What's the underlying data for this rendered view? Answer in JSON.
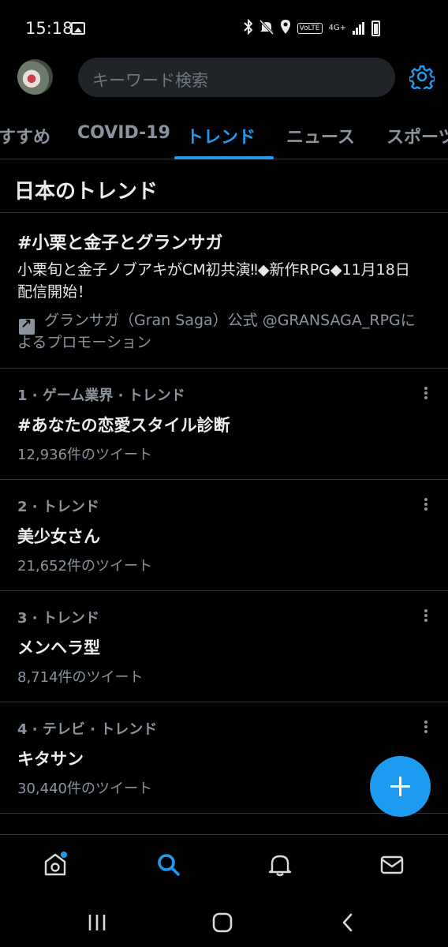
{
  "status_bar": {
    "time": "15:18",
    "volte": "VoLTE",
    "network": "4G+"
  },
  "header": {
    "search_placeholder": "キーワード検索"
  },
  "tabs": [
    {
      "label": "すすめ",
      "active": false
    },
    {
      "label": "COVID-19",
      "active": false
    },
    {
      "label": "トレンド",
      "active": true
    },
    {
      "label": "ニュース",
      "active": false
    },
    {
      "label": "スポーツ",
      "active": false
    }
  ],
  "section_title": "日本のトレンド",
  "promoted": {
    "title": "#小栗と金子とグランサガ",
    "description": "小栗旬と金子ノブアキがCM初共演‼◆新作RPG◆11月18日配信開始！",
    "promoted_by": "グランサガ（Gran Saga）公式 @GRANSAGA_RPGによるプロモーション"
  },
  "trends": [
    {
      "meta": "1 · ゲーム業界 · トレンド",
      "name": "#あなたの恋愛スタイル診断",
      "count": "12,936件のツイート"
    },
    {
      "meta": "2 · トレンド",
      "name": "美少女さん",
      "count": "21,652件のツイート"
    },
    {
      "meta": "3 · トレンド",
      "name": "メンヘラ型",
      "count": "8,714件のツイート"
    },
    {
      "meta": "4 · テレビ · トレンド",
      "name": "キタサン",
      "count": "30,440件のツイート"
    }
  ],
  "colors": {
    "accent": "#1d9bf0",
    "background": "#000000",
    "secondary_text": "#8b949e"
  },
  "bottom_nav": [
    "home-icon",
    "search-icon",
    "notifications-icon",
    "messages-icon"
  ],
  "system_nav": [
    "recents-icon",
    "home-circle-icon",
    "back-icon"
  ]
}
